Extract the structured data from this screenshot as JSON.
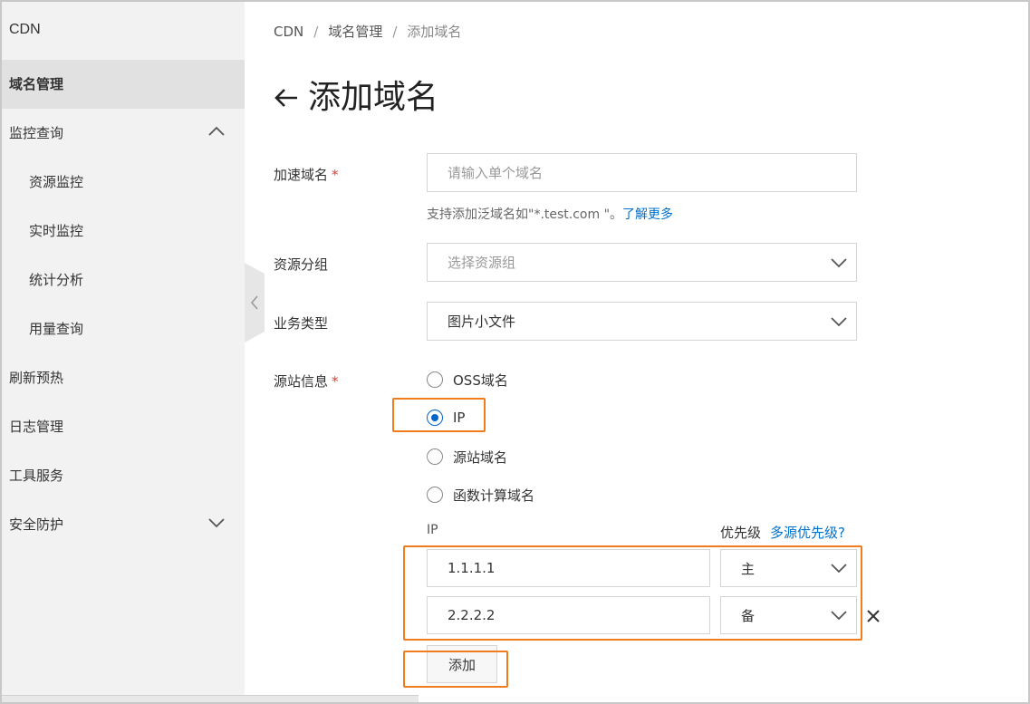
{
  "app": {
    "title": "CDN"
  },
  "sidebar": {
    "items": [
      {
        "label": "域名管理"
      },
      {
        "label": "监控查询"
      },
      {
        "label": "资源监控"
      },
      {
        "label": "实时监控"
      },
      {
        "label": "统计分析"
      },
      {
        "label": "用量查询"
      },
      {
        "label": "刷新预热"
      },
      {
        "label": "日志管理"
      },
      {
        "label": "工具服务"
      },
      {
        "label": "安全防护"
      }
    ]
  },
  "breadcrumb": {
    "items": [
      "CDN",
      "域名管理",
      "添加域名"
    ],
    "separator": "/"
  },
  "page": {
    "title": "添加域名"
  },
  "form": {
    "domain": {
      "label": "加速域名",
      "required_mark": "*",
      "placeholder": "请输入单个域名",
      "help_text": "支持添加泛域名如\"*.test.com \"。",
      "help_link": "了解更多"
    },
    "resource_group": {
      "label": "资源分组",
      "placeholder": "选择资源组"
    },
    "business_type": {
      "label": "业务类型",
      "value": "图片小文件"
    },
    "origin": {
      "label": "源站信息",
      "required_mark": "*",
      "options": [
        "OSS域名",
        "IP",
        "源站域名",
        "函数计算域名"
      ],
      "selected": "IP",
      "ip_header": "IP",
      "priority_header": "优先级",
      "priority_link": "多源优先级?",
      "rows": [
        {
          "ip": "1.1.1.1",
          "priority": "主"
        },
        {
          "ip": "2.2.2.2",
          "priority": "备"
        }
      ],
      "add_button": "添加"
    }
  },
  "colors": {
    "accent": "#0064c8",
    "link": "#0070cc",
    "highlight": "#f07c1e",
    "required": "#e23b2e",
    "sidebar_bg": "#f2f2f2",
    "sidebar_active": "#e1e1e1"
  }
}
